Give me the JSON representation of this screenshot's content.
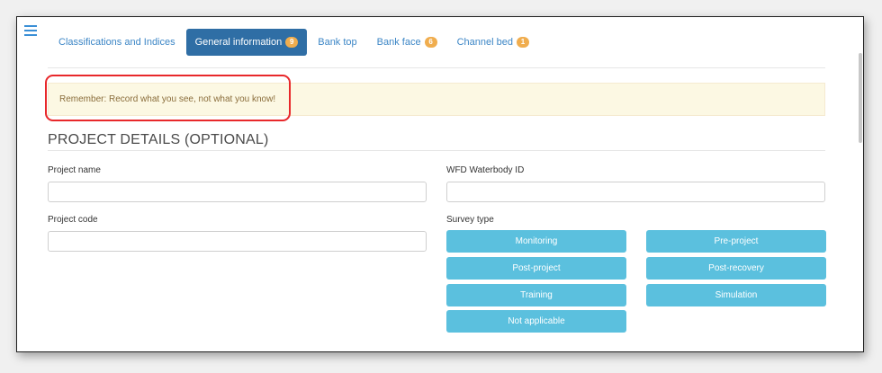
{
  "tabs": [
    {
      "label": "Classifications and Indices",
      "badge": null,
      "active": false
    },
    {
      "label": "General information",
      "badge": "9",
      "active": true
    },
    {
      "label": "Bank top",
      "badge": null,
      "active": false
    },
    {
      "label": "Bank face",
      "badge": "6",
      "active": false
    },
    {
      "label": "Channel bed",
      "badge": "1",
      "active": false
    }
  ],
  "alert": {
    "text": "Remember: Record what you see, not what you know!"
  },
  "section": {
    "title": "PROJECT DETAILS (OPTIONAL)"
  },
  "fields": {
    "project_name": {
      "label": "Project name",
      "value": "",
      "placeholder": ""
    },
    "wfd_id": {
      "label": "WFD Waterbody ID",
      "value": "",
      "placeholder": ""
    },
    "project_code": {
      "label": "Project code",
      "value": "",
      "placeholder": ""
    },
    "survey_type": {
      "label": "Survey type",
      "options": [
        "Monitoring",
        "Pre-project",
        "Post-project",
        "Post-recovery",
        "Training",
        "Simulation",
        "Not applicable"
      ]
    }
  },
  "colors": {
    "active_tab": "#2f6ea5",
    "tab_text": "#3c86c6",
    "badge": "#f0ad4e",
    "survey_button": "#5bc0de",
    "alert_bg": "#fcf8e3",
    "highlight": "#e8282b"
  },
  "icons": {
    "menu": "hamburger-menu-icon"
  }
}
